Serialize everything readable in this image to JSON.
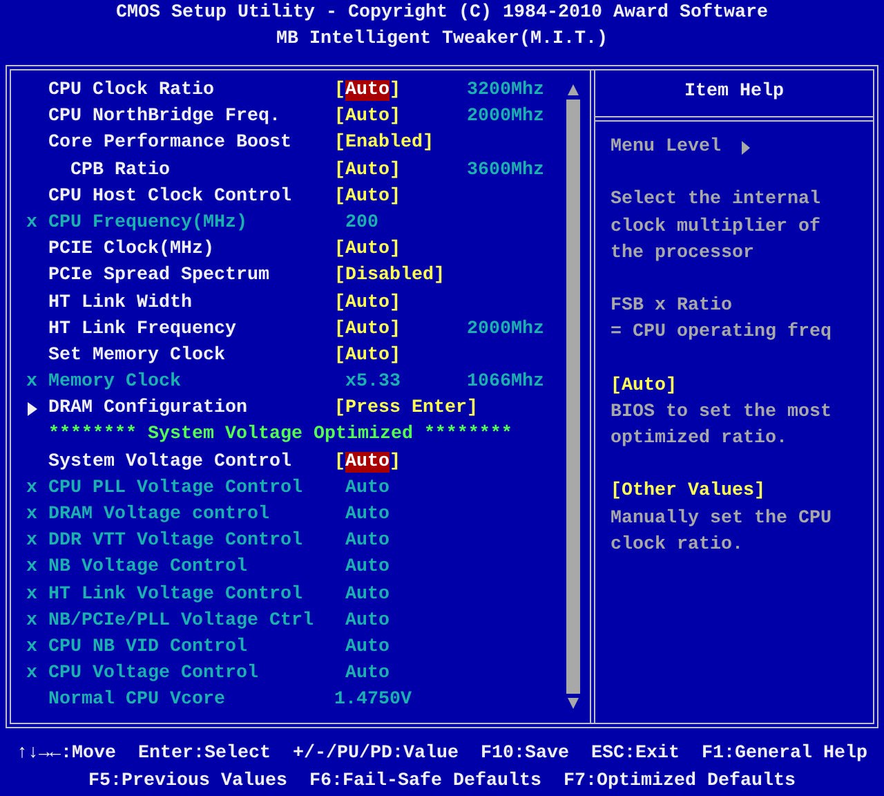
{
  "title": [
    "CMOS Setup Utility - Copyright (C) 1984-2010 Award Software",
    "MB Intelligent Tweaker(M.I.T.)"
  ],
  "settings": [
    {
      "kind": "setting",
      "label": "CPU Clock Ratio",
      "value": "[Auto]",
      "extra": "3200Mhz",
      "highlighted": true
    },
    {
      "kind": "setting",
      "label": "CPU NorthBridge Freq.",
      "value": "[Auto]",
      "extra": "2000Mhz",
      "highlighted": false
    },
    {
      "kind": "setting",
      "label": "Core Performance Boost",
      "value": "[Enabled]",
      "highlighted": false,
      "children": [
        {
          "kind": "setting",
          "label": "CPB Ratio",
          "value": "[Auto]",
          "extra": "3600Mhz",
          "highlighted": false
        }
      ]
    },
    {
      "kind": "setting",
      "label": "CPU Host Clock Control",
      "value": "[Auto]",
      "highlighted": false
    },
    {
      "kind": "locked",
      "marker": "x",
      "label": "CPU Frequency(MHz)",
      "value": "200"
    },
    {
      "kind": "setting",
      "label": "PCIE Clock(MHz)",
      "value": "[Auto]",
      "highlighted": false
    },
    {
      "kind": "setting",
      "label": "PCIe Spread Spectrum",
      "value": "[Disabled]",
      "highlighted": false
    },
    {
      "kind": "setting",
      "label": "HT Link Width",
      "value": "[Auto]",
      "highlighted": false
    },
    {
      "kind": "setting",
      "label": "HT Link Frequency",
      "value": "[Auto]",
      "extra": "2000Mhz",
      "highlighted": false
    },
    {
      "kind": "setting",
      "label": "Set Memory Clock",
      "value": "[Auto]",
      "highlighted": false
    },
    {
      "kind": "locked",
      "marker": "x",
      "label": "Memory Clock",
      "value": "x5.33",
      "extra": "1066Mhz"
    },
    {
      "kind": "submenu",
      "label": "DRAM Configuration",
      "value": "[Press Enter]"
    },
    {
      "kind": "banner",
      "label": "******** System Voltage Optimized ********"
    },
    {
      "kind": "setting",
      "label": "System Voltage Control",
      "value": "[Auto]",
      "highlighted": true
    },
    {
      "kind": "locked",
      "marker": "x",
      "label": "CPU PLL Voltage Control",
      "value": "Auto"
    },
    {
      "kind": "locked",
      "marker": "x",
      "label": "DRAM Voltage control",
      "value": "Auto"
    },
    {
      "kind": "locked",
      "marker": "x",
      "label": "DDR VTT Voltage Control",
      "value": "Auto"
    },
    {
      "kind": "locked",
      "marker": "x",
      "label": "NB Voltage Control",
      "value": "Auto"
    },
    {
      "kind": "locked",
      "marker": "x",
      "label": "HT Link Voltage Control",
      "value": "Auto"
    },
    {
      "kind": "locked",
      "marker": "x",
      "label": "NB/PCIe/PLL Voltage Ctrl",
      "value": "Auto"
    },
    {
      "kind": "locked",
      "marker": "x",
      "label": "CPU NB VID Control",
      "value": "Auto"
    },
    {
      "kind": "locked",
      "marker": "x",
      "label": "CPU Voltage Control",
      "value": "Auto"
    },
    {
      "kind": "info",
      "label": "Normal CPU Vcore",
      "value": "1.4750V"
    }
  ],
  "help": {
    "title": "Item Help",
    "menu_level": "Menu Level",
    "paragraphs": [
      {
        "kind": "text",
        "lines": [
          "Select the internal",
          "clock multiplier of",
          "the processor"
        ]
      },
      {
        "kind": "text",
        "lines": [
          "FSB x Ratio",
          "= CPU operating freq"
        ]
      },
      {
        "kind": "option",
        "heading": "[Auto]",
        "lines": [
          "BIOS to set the most",
          "optimized ratio."
        ]
      },
      {
        "kind": "option",
        "heading": "[Other Values]",
        "lines": [
          "Manually set the CPU",
          "clock ratio."
        ]
      }
    ]
  },
  "footer": [
    [
      "↑↓→←:Move",
      "Enter:Select",
      "+/-/PU/PD:Value",
      "F10:Save",
      "ESC:Exit",
      "F1:General Help"
    ],
    [
      "F5:Previous Values",
      "F6:Fail-Safe Defaults",
      "F7:Optimized Defaults"
    ]
  ]
}
